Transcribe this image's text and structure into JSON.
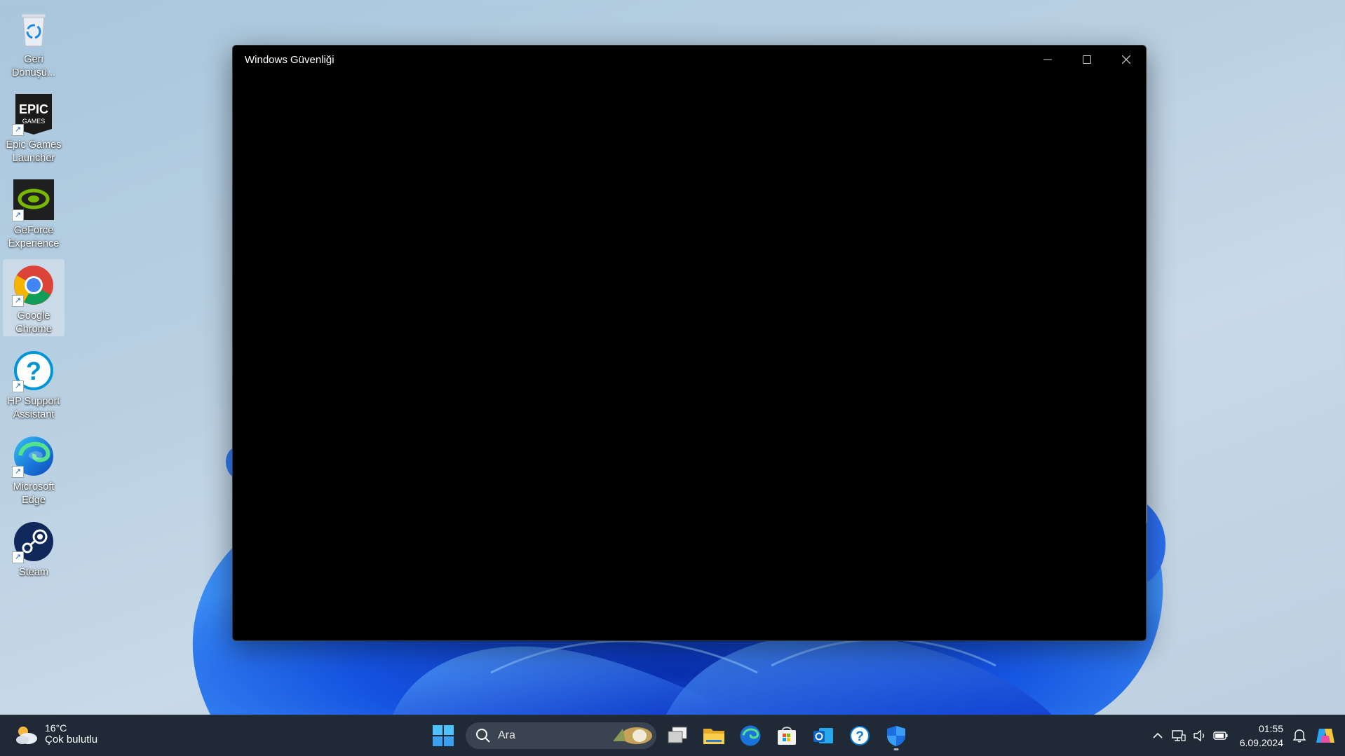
{
  "window": {
    "title": "Windows Güvenliği"
  },
  "desktop": {
    "icons": [
      {
        "label": "Geri Dönüşü...",
        "icon": "recycle-bin-icon"
      },
      {
        "label": "Epic Games Launcher",
        "icon": "epic-games-icon"
      },
      {
        "label": "GeForce Experience",
        "icon": "nvidia-geforce-icon"
      },
      {
        "label": "Google Chrome",
        "icon": "chrome-icon",
        "selected": true
      },
      {
        "label": "HP Support Assistant",
        "icon": "hp-support-icon"
      },
      {
        "label": "Microsoft Edge",
        "icon": "edge-icon"
      },
      {
        "label": "Steam",
        "icon": "steam-icon"
      }
    ]
  },
  "taskbar": {
    "weather": {
      "temp": "16°C",
      "desc": "Çok bulutlu"
    },
    "search_placeholder": "Ara",
    "pinned": [
      "start-icon",
      "task-view-icon",
      "file-explorer-icon",
      "edge-icon",
      "microsoft-store-icon",
      "outlook-icon",
      "help-icon",
      "windows-security-icon"
    ],
    "clock": {
      "time": "01:55",
      "date": "6.09.2024"
    }
  }
}
